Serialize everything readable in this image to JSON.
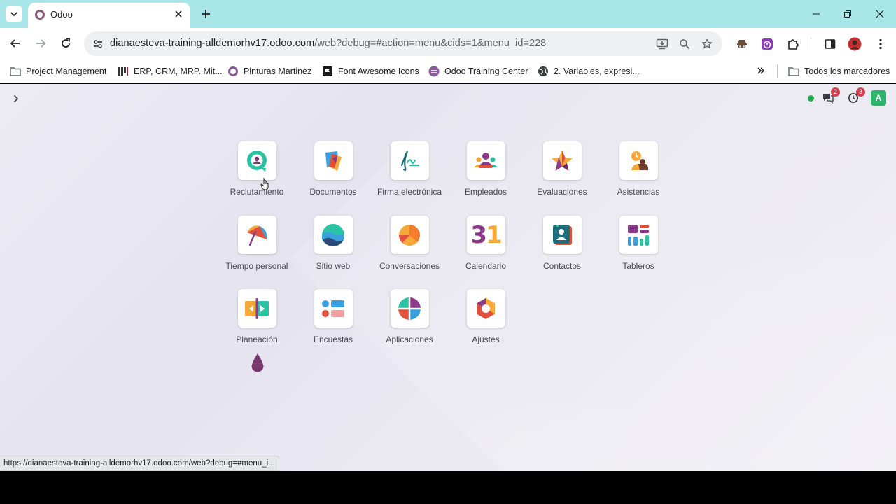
{
  "browser": {
    "tab_title": "Odoo",
    "url_host": "dianaesteva-training-alldemorhv17.odoo.com",
    "url_path": "/web?debug=#action=menu&cids=1&menu_id=228"
  },
  "bookmarks": [
    {
      "label": "Project Management",
      "icon": "folder-icon"
    },
    {
      "label": "ERP, CRM, MRP. Mit...",
      "icon": "mit-icon"
    },
    {
      "label": "Pinturas Martinez",
      "icon": "odoo-o-icon"
    },
    {
      "label": "Font Awesome Icons",
      "icon": "flag-icon"
    },
    {
      "label": "Odoo Training Center",
      "icon": "odoo-training-icon"
    },
    {
      "label": "2. Variables, expresi...",
      "icon": "globe-icon"
    }
  ],
  "bookmarks_all": "Todos los marcadores",
  "systray": {
    "messages_count": "2",
    "activities_count": "3",
    "avatar_letter": "A"
  },
  "apps": [
    {
      "label": "Reclutamiento"
    },
    {
      "label": "Documentos"
    },
    {
      "label": "Firma electrónica"
    },
    {
      "label": "Empleados"
    },
    {
      "label": "Evaluaciones"
    },
    {
      "label": "Asistencias"
    },
    {
      "label": "Tiempo personal"
    },
    {
      "label": "Sitio web"
    },
    {
      "label": "Conversaciones"
    },
    {
      "label": "Calendario"
    },
    {
      "label": "Contactos"
    },
    {
      "label": "Tableros"
    },
    {
      "label": "Planeación"
    },
    {
      "label": "Encuestas"
    },
    {
      "label": "Aplicaciones"
    },
    {
      "label": "Ajustes"
    }
  ],
  "calendar_icon_text": "31",
  "status_url": "https://dianaesteva-training-alldemorhv17.odoo.com/web?debug=#menu_i..."
}
